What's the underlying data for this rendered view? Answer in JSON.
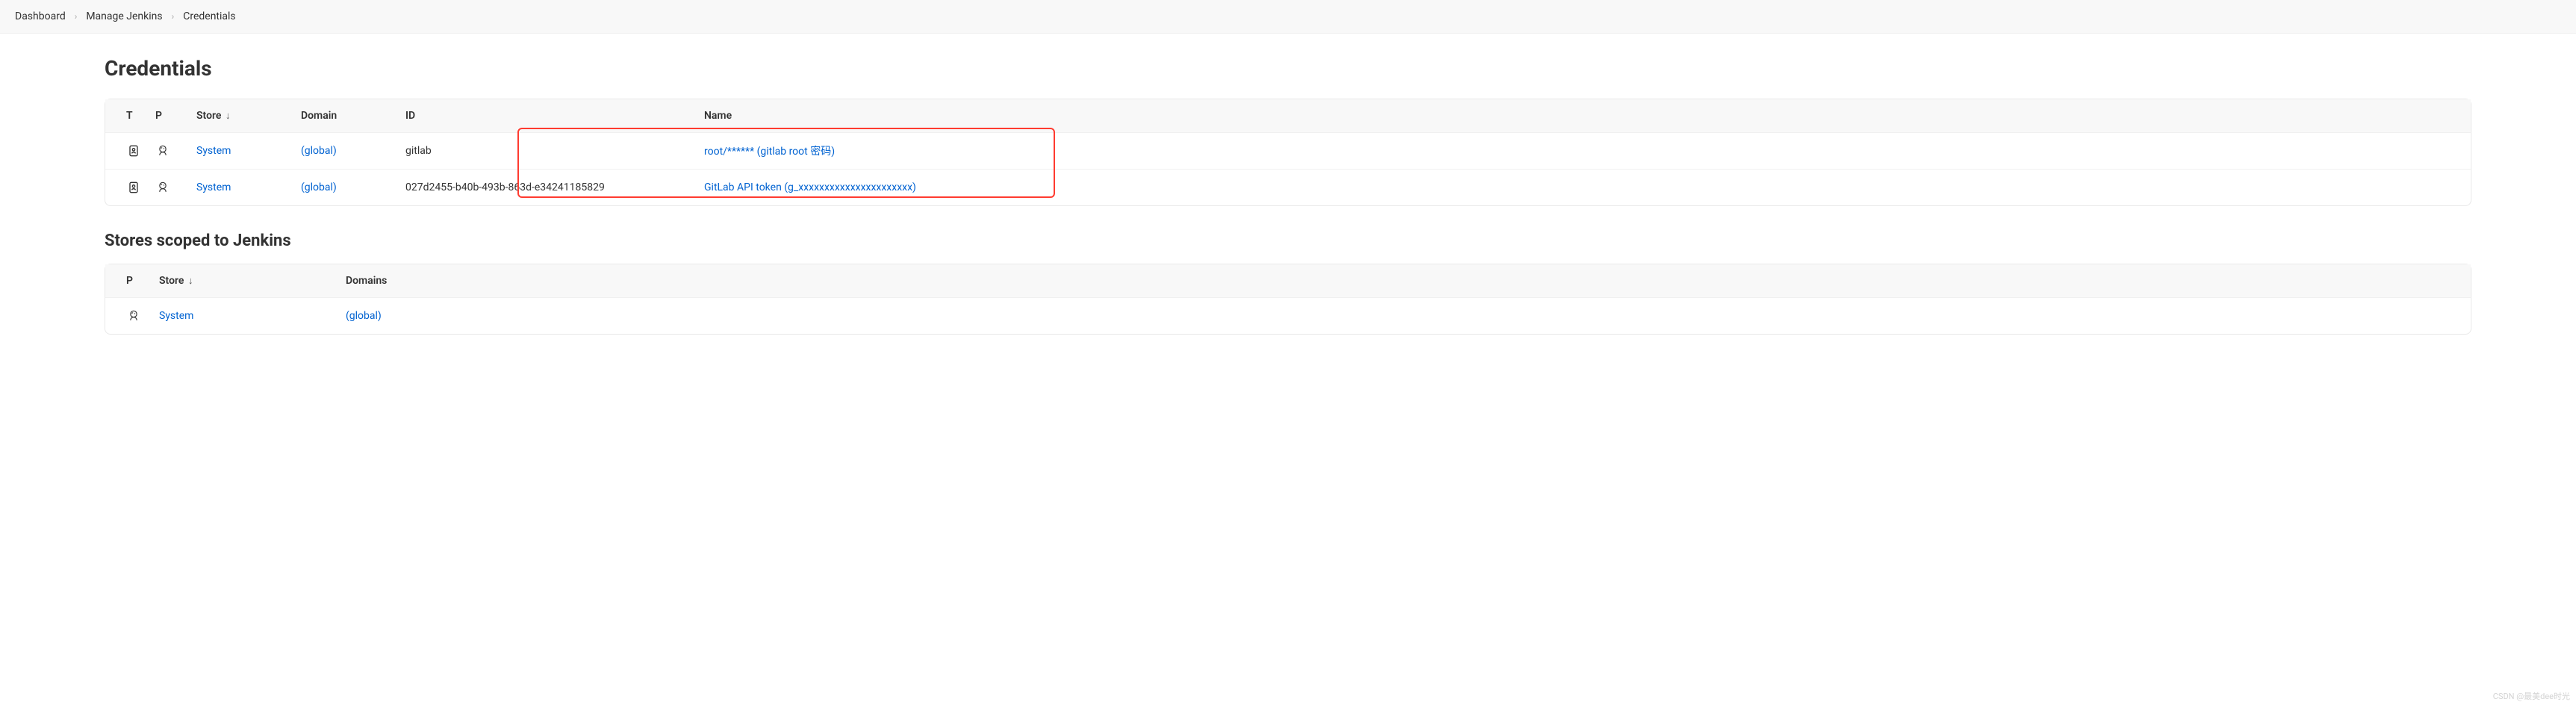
{
  "breadcrumb": {
    "items": [
      {
        "label": "Dashboard"
      },
      {
        "label": "Manage Jenkins"
      },
      {
        "label": "Credentials"
      }
    ]
  },
  "page_title": "Credentials",
  "cred_table": {
    "headers": {
      "t": "T",
      "p": "P",
      "store": "Store",
      "sort_indicator": "↓",
      "domain": "Domain",
      "id": "ID",
      "name": "Name"
    },
    "rows": [
      {
        "store": "System",
        "domain": "(global)",
        "id": "gitlab",
        "name": "root/****** (gitlab root 密码)"
      },
      {
        "store": "System",
        "domain": "(global)",
        "id": "027d2455-b40b-493b-863d-e34241185829",
        "name": "GitLab API token (g_xxxxxxxxxxxxxxxxxxxxxx)"
      }
    ]
  },
  "stores_section": {
    "title": "Stores scoped to Jenkins",
    "headers": {
      "p": "P",
      "store": "Store",
      "sort_indicator": "↓",
      "domains": "Domains"
    },
    "rows": [
      {
        "store": "System",
        "domains": "(global)"
      }
    ]
  },
  "watermark": "CSDN @最美dee时光"
}
